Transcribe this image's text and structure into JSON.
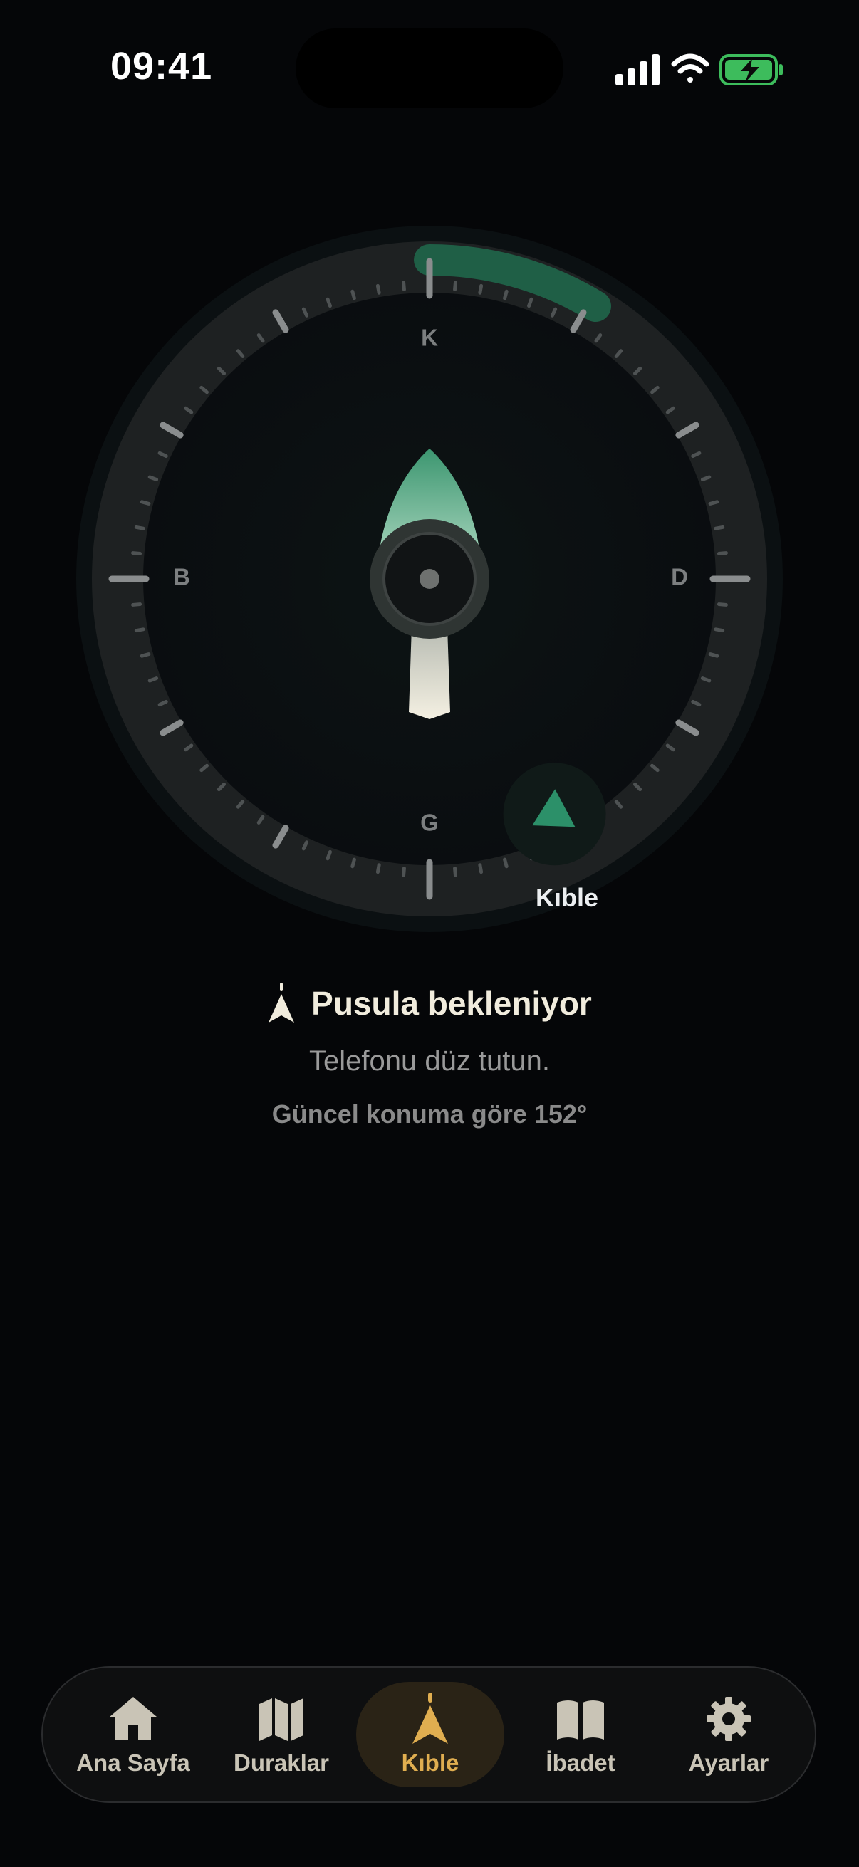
{
  "status": {
    "time": "09:41"
  },
  "compass": {
    "north": "K",
    "east": "D",
    "south": "G",
    "west": "B",
    "qibla_label": "Kıble",
    "qibla_bearing_deg": 152
  },
  "info": {
    "title": "Pusula bekleniyor",
    "subtitle": "Telefonu düz tutun.",
    "bearing_text": "Güncel konuma göre 152°"
  },
  "tabs": [
    {
      "label": "Ana Sayfa",
      "icon": "home-icon"
    },
    {
      "label": "Duraklar",
      "icon": "map-icon"
    },
    {
      "label": "Kıble",
      "icon": "qibla-icon",
      "active": true
    },
    {
      "label": "İbadet",
      "icon": "book-icon"
    },
    {
      "label": "Ayarlar",
      "icon": "gear-icon"
    }
  ],
  "colors": {
    "accent_gold": "#E0AE50",
    "needle_green": "#3E9B74",
    "background": "#050608"
  }
}
